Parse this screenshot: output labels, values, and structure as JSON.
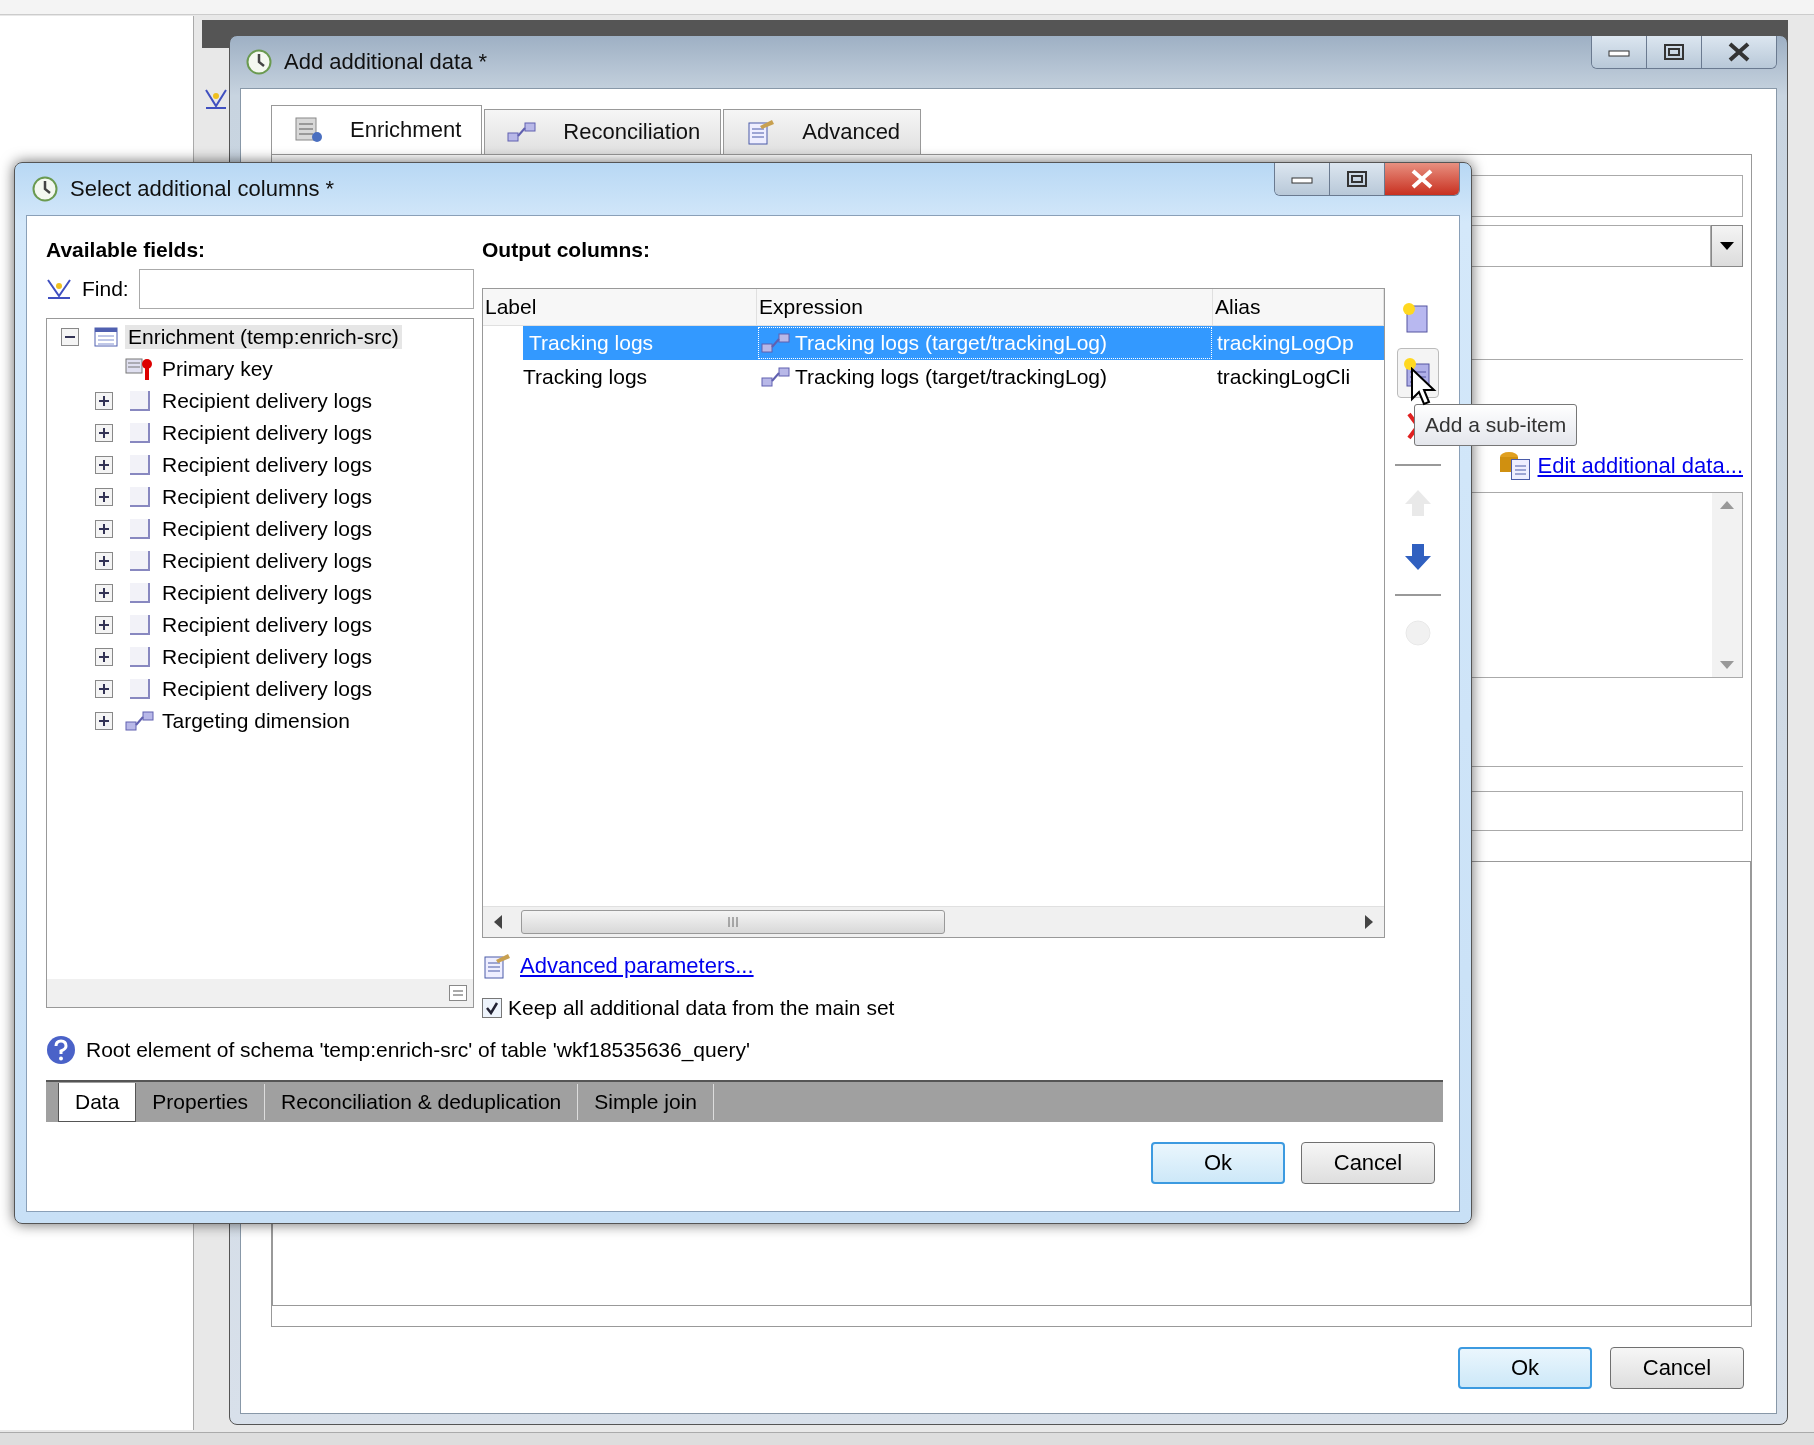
{
  "back_window": {
    "title": "Add additional data *",
    "tabs": [
      {
        "label": "Enrichment",
        "kind": "enrichment",
        "selected": true
      },
      {
        "label": "Reconciliation",
        "kind": "link",
        "selected": false
      },
      {
        "label": "Advanced",
        "kind": "advanced",
        "selected": false
      }
    ],
    "edit_link": "Edit additional data...",
    "buttons": [
      {
        "label": "Ok",
        "kind": "default"
      },
      {
        "label": "Cancel",
        "kind": "normal"
      }
    ]
  },
  "dialog": {
    "title": "Select additional columns *",
    "available_fields": {
      "label": "Available fields:",
      "find_label": "Find:",
      "tree": [
        {
          "label": "Enrichment (temp:enrich-src)",
          "kind": "table",
          "expanded": true,
          "selected": true,
          "children": [
            {
              "label": "Primary key",
              "kind": "key",
              "selected": false
            },
            {
              "label": "Recipient delivery logs",
              "kind": "node",
              "expanded": false,
              "selected": false
            },
            {
              "label": "Recipient delivery logs",
              "kind": "node",
              "expanded": false,
              "selected": false
            },
            {
              "label": "Recipient delivery logs",
              "kind": "node",
              "expanded": false,
              "selected": false
            },
            {
              "label": "Recipient delivery logs",
              "kind": "node",
              "expanded": false,
              "selected": false
            },
            {
              "label": "Recipient delivery logs",
              "kind": "node",
              "expanded": false,
              "selected": false
            },
            {
              "label": "Recipient delivery logs",
              "kind": "node",
              "expanded": false,
              "selected": false
            },
            {
              "label": "Recipient delivery logs",
              "kind": "node",
              "expanded": false,
              "selected": false
            },
            {
              "label": "Recipient delivery logs",
              "kind": "node",
              "expanded": false,
              "selected": false
            },
            {
              "label": "Recipient delivery logs",
              "kind": "node",
              "expanded": false,
              "selected": false
            },
            {
              "label": "Recipient delivery logs",
              "kind": "node",
              "expanded": false,
              "selected": false
            },
            {
              "label": "Targeting dimension",
              "kind": "link",
              "expanded": false,
              "selected": false
            }
          ]
        }
      ]
    },
    "output_columns": {
      "label": "Output columns:",
      "columns": [
        "Label",
        "Expression",
        "Alias"
      ],
      "rows": [
        {
          "label": "Tracking logs",
          "expression": "Tracking logs (target/trackingLog)",
          "alias": "trackingLogOp",
          "selected": true
        },
        {
          "label": "Tracking logs",
          "expression": "Tracking logs (target/trackingLog)",
          "alias": "trackingLogCli",
          "selected": false
        }
      ],
      "toolbar": [
        {
          "kind": "new",
          "disabled": false,
          "hovered": false
        },
        {
          "kind": "sub-item",
          "disabled": false,
          "hovered": true
        },
        {
          "kind": "delete",
          "disabled": false,
          "hovered": false
        },
        {
          "kind": "separator"
        },
        {
          "kind": "up",
          "disabled": true,
          "hovered": false
        },
        {
          "kind": "down",
          "disabled": false,
          "hovered": false
        },
        {
          "kind": "separator"
        },
        {
          "kind": "sort",
          "disabled": true,
          "hovered": false
        }
      ],
      "tooltip": "Add a sub-item"
    },
    "advanced_link": "Advanced parameters...",
    "keep_data": {
      "label": "Keep all additional data from the main set",
      "checked": true
    },
    "info": "Root element of schema 'temp:enrich-src' of table 'wkf18535636_query'",
    "bottom_tabs": [
      {
        "label": "Data",
        "selected": true
      },
      {
        "label": "Properties",
        "selected": false
      },
      {
        "label": "Reconciliation & deduplication",
        "selected": false
      },
      {
        "label": "Simple join",
        "selected": false
      }
    ],
    "buttons": [
      {
        "label": "Ok",
        "kind": "default"
      },
      {
        "label": "Cancel",
        "kind": "normal"
      }
    ]
  }
}
